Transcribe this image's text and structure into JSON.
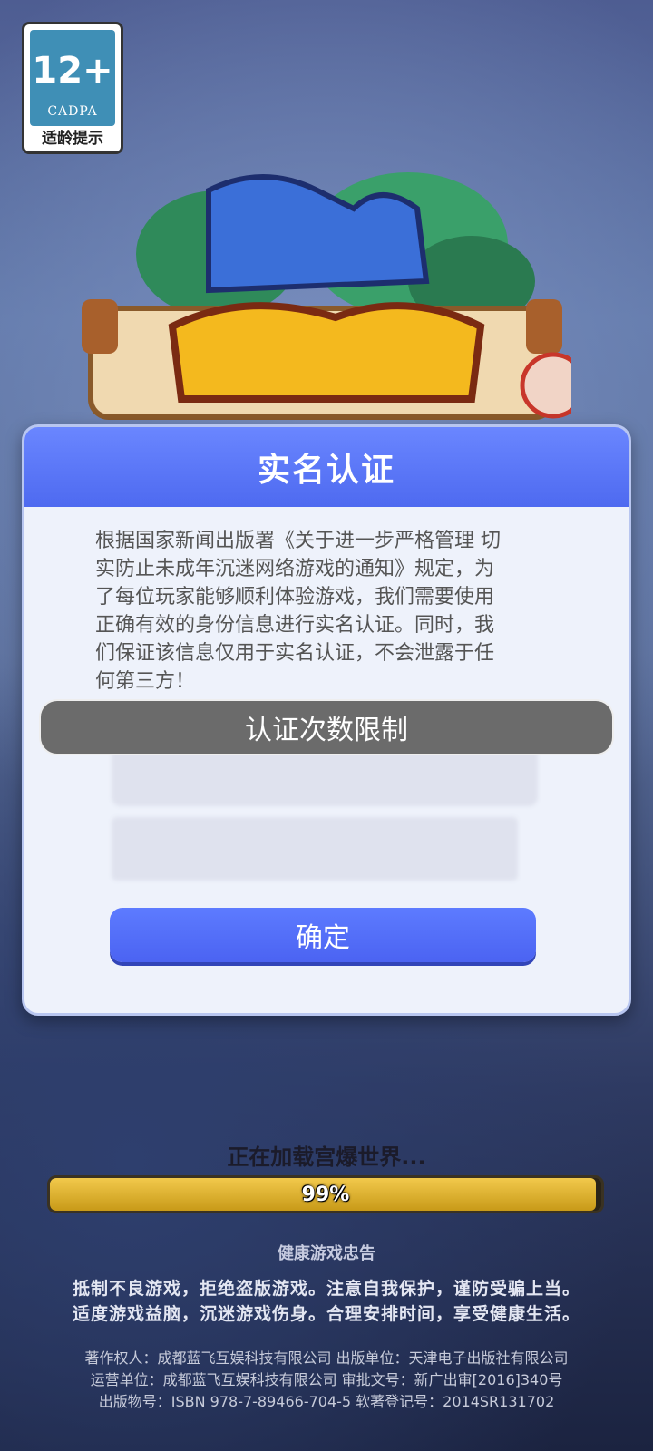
{
  "age_rating": {
    "number": "12+",
    "org": "CADPA",
    "hint": "适龄提示"
  },
  "modal": {
    "title": "实名认证",
    "body_lines": [
      "根据国家新闻出版署《关于进一步严格管理 切",
      "实防止未成年沉迷网络游戏的通知》规定，为",
      "了每位玩家能够顺利体验游戏，我们需要使用",
      "正确有效的身份信息进行实名认证。同时，我",
      "们保证该信息仅用于实名认证，不会泄露于任",
      "何第三方！"
    ],
    "toast": "认证次数限制",
    "confirm_label": "确定"
  },
  "loading": {
    "label": "正在加载宫爆世界...",
    "progress_text": "99%",
    "progress_value": 0.99
  },
  "health_notice": {
    "title": "健康游戏忠告",
    "lines": [
      "抵制不良游戏，拒绝盗版游戏。注意自我保护，谨防受骗上当。",
      "适度游戏益脑，沉迷游戏伤身。合理安排时间，享受健康生活。"
    ]
  },
  "credits": [
    "著作权人：成都蓝飞互娱科技有限公司  出版单位：天津电子出版社有限公司",
    "运营单位：成都蓝飞互娱科技有限公司  审批文号：新广出审[2016]340号",
    "出版物号：ISBN 978-7-89466-704-5  软著登记号：2014SR131702"
  ],
  "colors": {
    "modal_header": "#4e6af0",
    "confirm_button": "#4b63f2",
    "progress_fill": "#f2c94c"
  }
}
